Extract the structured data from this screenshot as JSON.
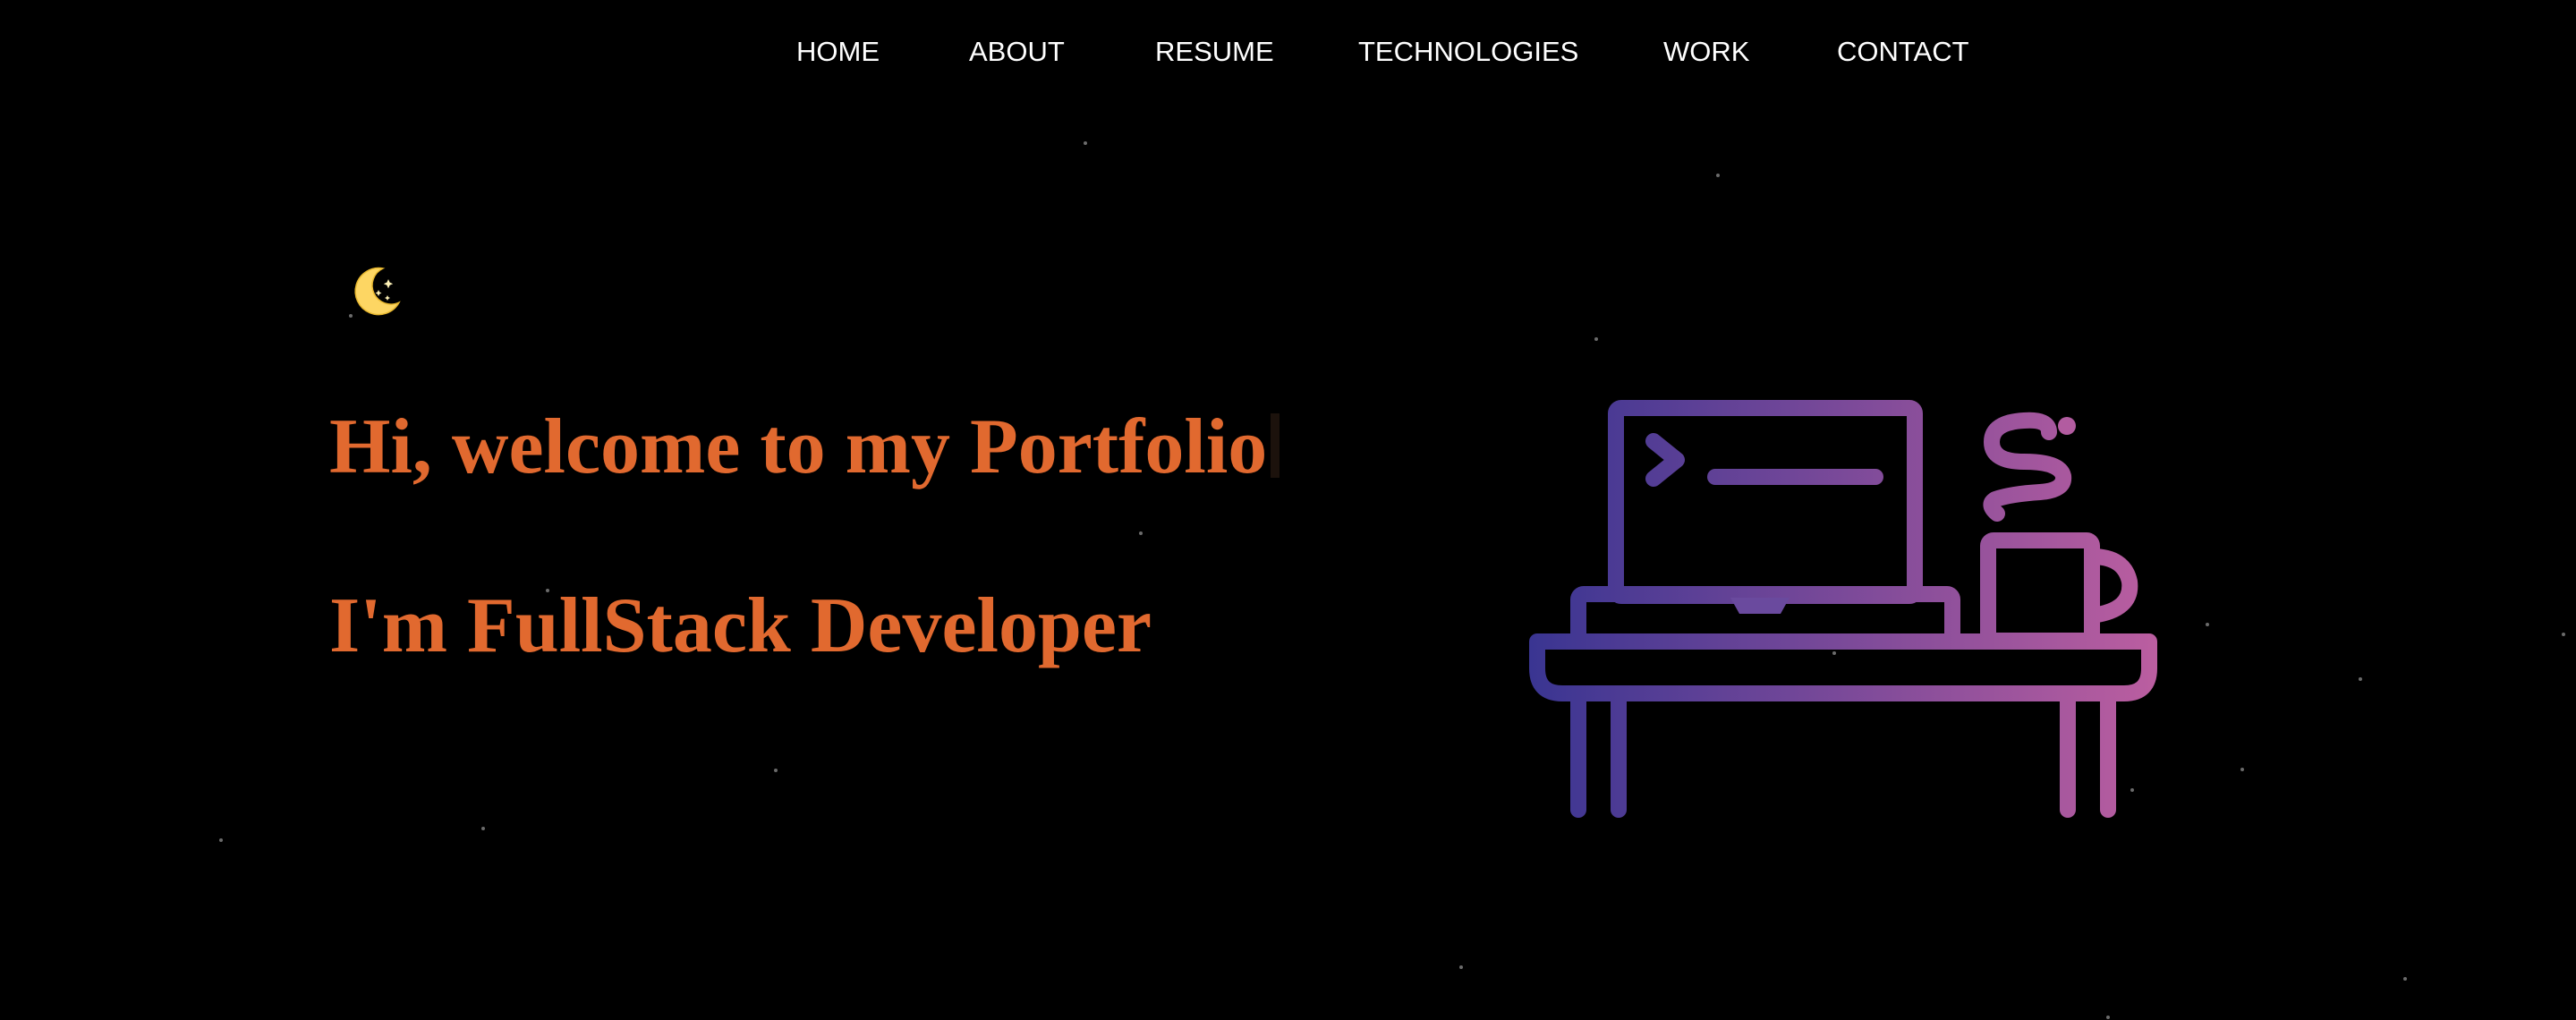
{
  "nav": {
    "items": [
      {
        "label": "HOME"
      },
      {
        "label": "ABOUT"
      },
      {
        "label": "RESUME"
      },
      {
        "label": "TECHNOLOGIES"
      },
      {
        "label": "WORK"
      },
      {
        "label": "CONTACT"
      }
    ]
  },
  "theme_toggle": {
    "icon": "crescent-moon-icon",
    "color": "#fdd663"
  },
  "hero": {
    "greeting": "Hi, welcome to my Portfolio",
    "role": "I'm FullStack Developer"
  },
  "illustration": {
    "icon": "desk-laptop-coffee-icon",
    "gradient_start": "#3a3592",
    "gradient_end": "#bb5ea0"
  },
  "colors": {
    "background": "#000000",
    "accent": "#e1692f",
    "nav_text": "#ffffff",
    "stars": "#6b6b6b"
  }
}
